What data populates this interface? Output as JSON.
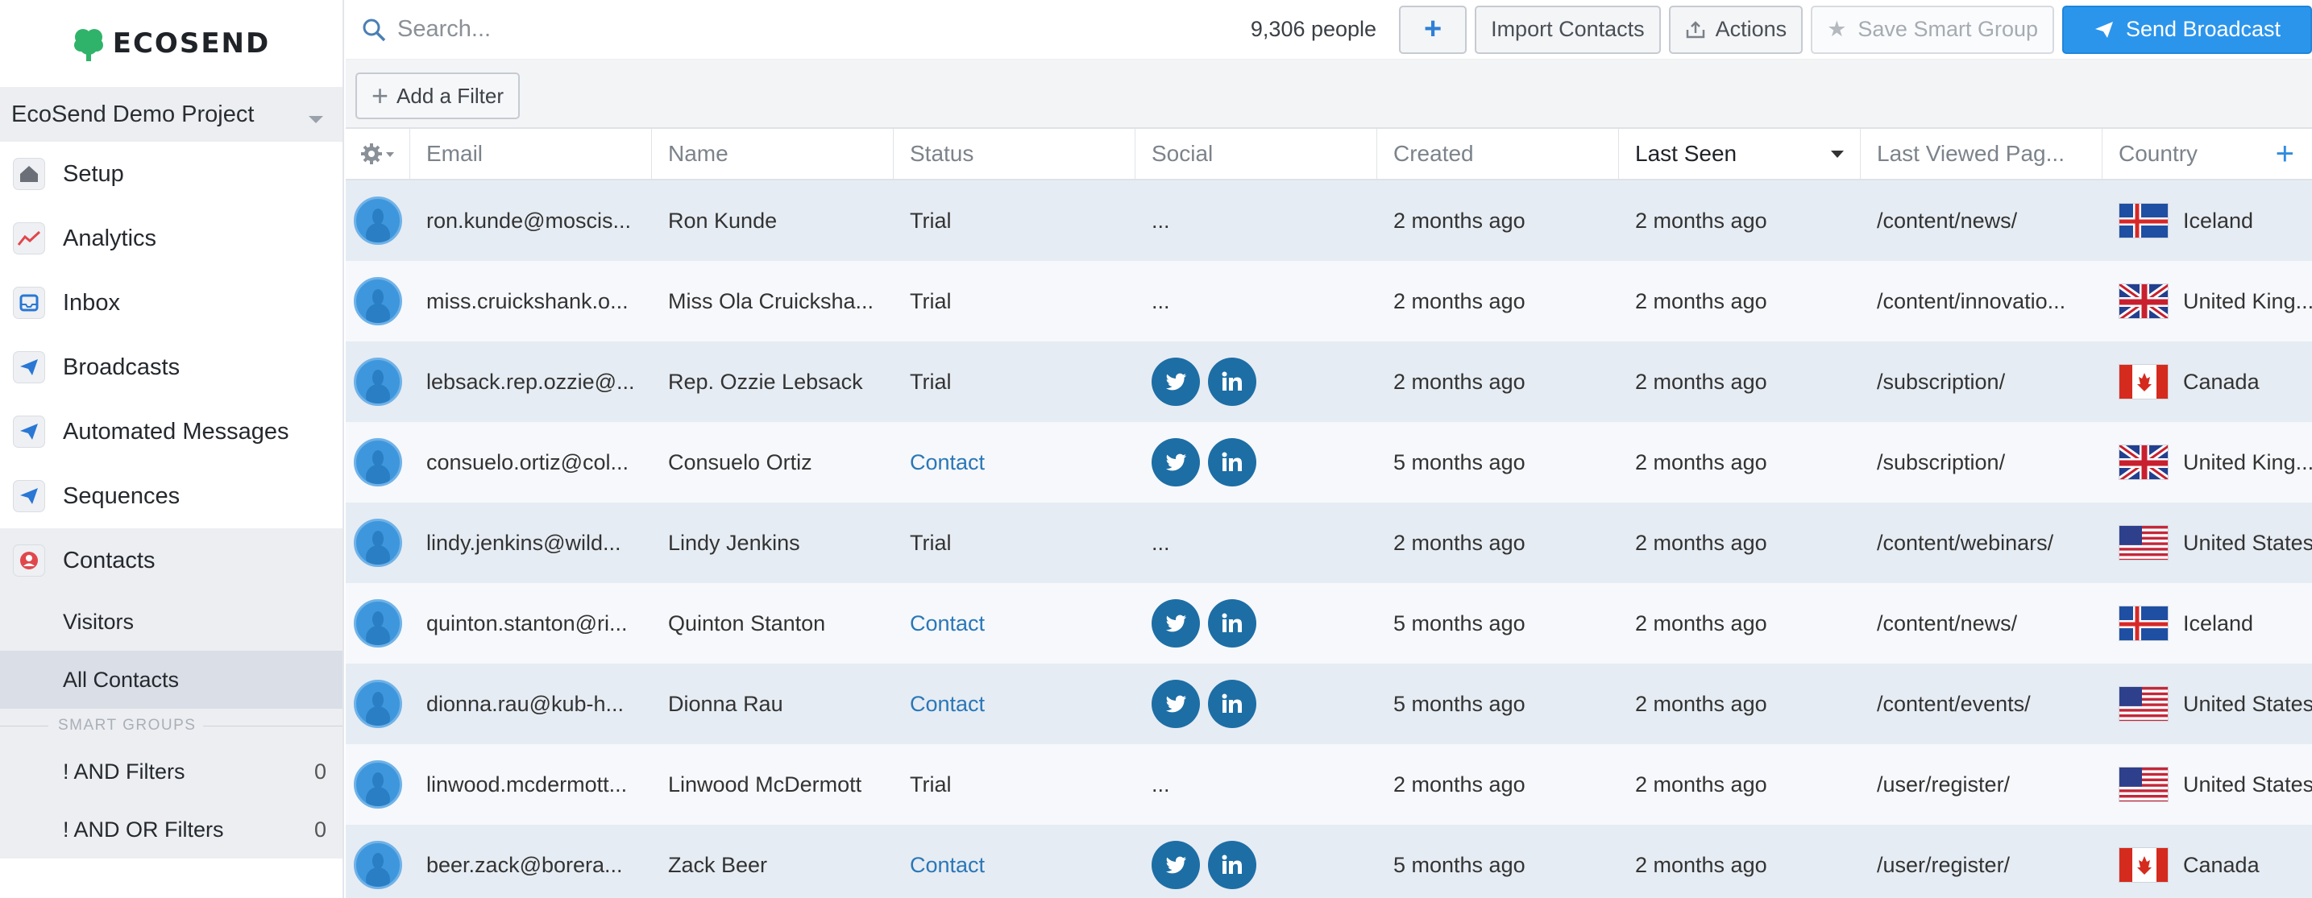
{
  "brand": {
    "name": "ECOSEND"
  },
  "project": {
    "name": "EcoSend Demo Project"
  },
  "sidebar": {
    "items": [
      {
        "label": "Setup",
        "icon": "home-icon"
      },
      {
        "label": "Analytics",
        "icon": "chart-icon"
      },
      {
        "label": "Inbox",
        "icon": "inbox-icon"
      },
      {
        "label": "Broadcasts",
        "icon": "paper-plane-icon"
      },
      {
        "label": "Automated Messages",
        "icon": "paper-plane-icon"
      },
      {
        "label": "Sequences",
        "icon": "paper-plane-icon"
      },
      {
        "label": "Contacts",
        "icon": "user-icon"
      }
    ],
    "contacts_sub": [
      {
        "label": "Visitors"
      },
      {
        "label": "All Contacts"
      }
    ],
    "smart_groups_header": "SMART GROUPS",
    "smart_groups": [
      {
        "label": "! AND Filters",
        "count": "0"
      },
      {
        "label": "! AND OR Filters",
        "count": "0"
      }
    ]
  },
  "toolbar": {
    "search_placeholder": "Search...",
    "people_count": "9,306 people",
    "plus_label": "+",
    "import_label": "Import Contacts",
    "actions_label": "Actions",
    "save_group_label": "Save Smart Group",
    "send_broadcast_label": "Send Broadcast"
  },
  "filters": {
    "add_label": "Add a Filter"
  },
  "table": {
    "headers": [
      "Email",
      "Name",
      "Status",
      "Social",
      "Created",
      "Last Seen",
      "Last Viewed Pag...",
      "Country"
    ],
    "sorted_column": "Last Seen",
    "rows": [
      {
        "email": "ron.kunde@moscis...",
        "name": "Ron Kunde",
        "status": "Trial",
        "social": "...",
        "created": "2 months ago",
        "last_seen": "2 months ago",
        "page": "/content/news/",
        "country": "Iceland",
        "flag": "iceland"
      },
      {
        "email": "miss.cruickshank.o...",
        "name": "Miss Ola Cruicksha...",
        "status": "Trial",
        "social": "...",
        "created": "2 months ago",
        "last_seen": "2 months ago",
        "page": "/content/innovatio...",
        "country": "United King...",
        "flag": "uk"
      },
      {
        "email": "lebsack.rep.ozzie@...",
        "name": "Rep. Ozzie Lebsack",
        "status": "Trial",
        "social": "icons",
        "created": "2 months ago",
        "last_seen": "2 months ago",
        "page": "/subscription/",
        "country": "Canada",
        "flag": "canada"
      },
      {
        "email": "consuelo.ortiz@col...",
        "name": "Consuelo Ortiz",
        "status": "Contact",
        "social": "icons",
        "created": "5 months ago",
        "last_seen": "2 months ago",
        "page": "/subscription/",
        "country": "United King...",
        "flag": "uk"
      },
      {
        "email": "lindy.jenkins@wild...",
        "name": "Lindy Jenkins",
        "status": "Trial",
        "social": "...",
        "created": "2 months ago",
        "last_seen": "2 months ago",
        "page": "/content/webinars/",
        "country": "United States",
        "flag": "us"
      },
      {
        "email": "quinton.stanton@ri...",
        "name": "Quinton Stanton",
        "status": "Contact",
        "social": "icons",
        "created": "5 months ago",
        "last_seen": "2 months ago",
        "page": "/content/news/",
        "country": "Iceland",
        "flag": "iceland"
      },
      {
        "email": "dionna.rau@kub-h...",
        "name": "Dionna Rau",
        "status": "Contact",
        "social": "icons",
        "created": "5 months ago",
        "last_seen": "2 months ago",
        "page": "/content/events/",
        "country": "United States",
        "flag": "us"
      },
      {
        "email": "linwood.mcdermott...",
        "name": "Linwood McDermott",
        "status": "Trial",
        "social": "...",
        "created": "2 months ago",
        "last_seen": "2 months ago",
        "page": "/user/register/",
        "country": "United States",
        "flag": "us"
      },
      {
        "email": "beer.zack@borera...",
        "name": "Zack Beer",
        "status": "Contact",
        "social": "icons",
        "created": "5 months ago",
        "last_seen": "2 months ago",
        "page": "/user/register/",
        "country": "Canada",
        "flag": "canada"
      }
    ]
  },
  "colors": {
    "accent": "#2b95ec",
    "link": "#2a77b8",
    "social": "#1d6ea5",
    "brand_green": "#2fb36a"
  }
}
